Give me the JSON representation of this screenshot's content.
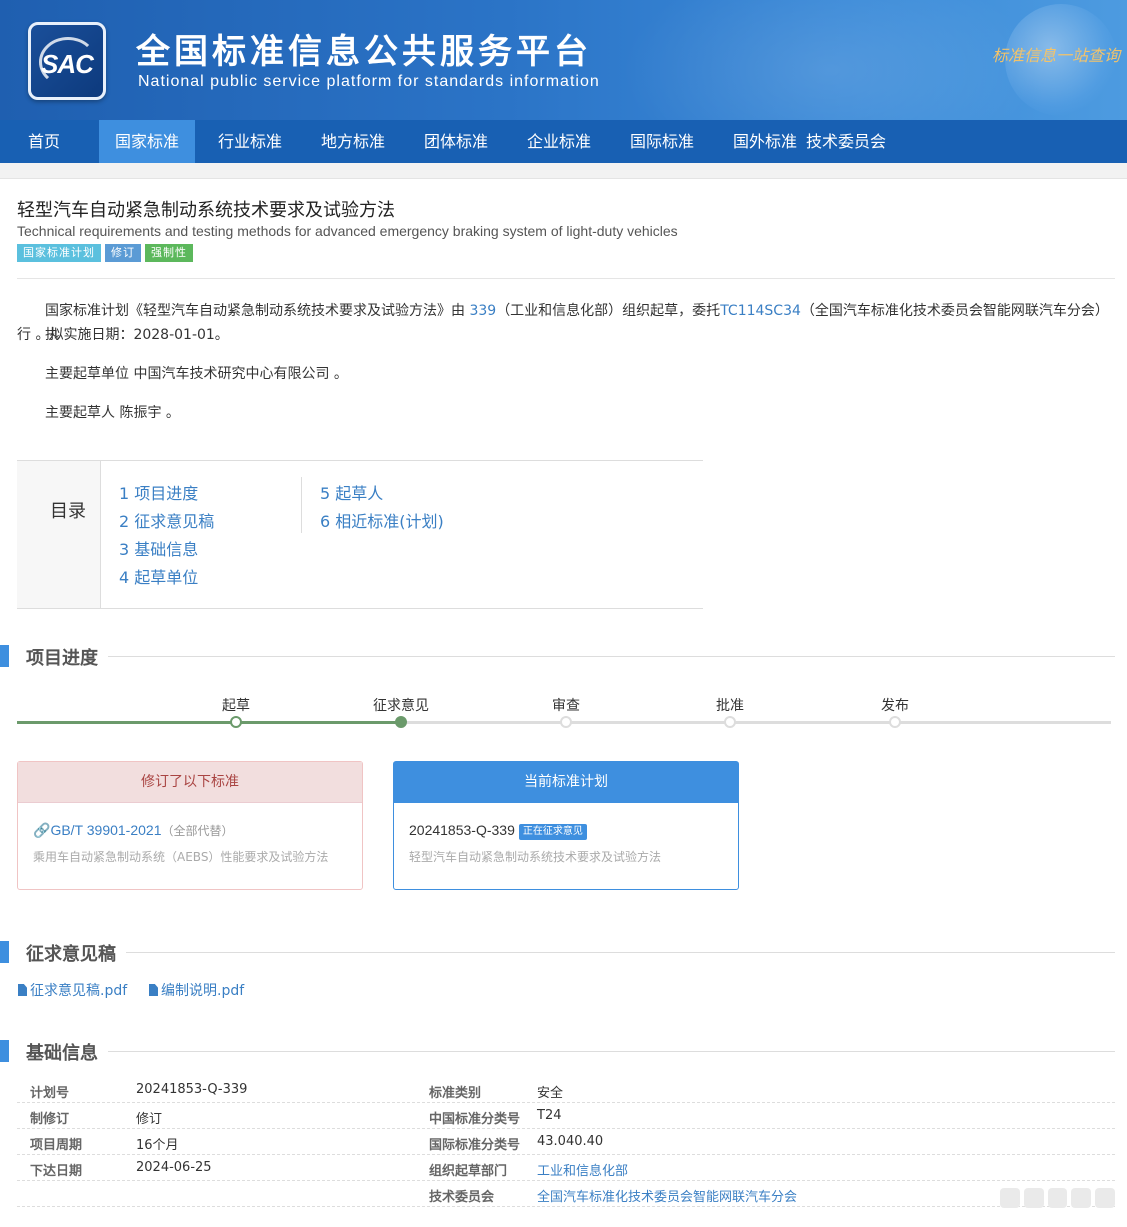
{
  "site": {
    "logo_text": "SAC",
    "title": "全国标准信息公共服务平台",
    "subtitle": "National public service platform  for standards information",
    "slogan": "标准信息一站查询"
  },
  "nav": [
    "首页",
    "国家标准",
    "行业标准",
    "地方标准",
    "团体标准",
    "企业标准",
    "国际标准",
    "国外标准",
    "技术委员会"
  ],
  "nav_active": "国家标准",
  "standard": {
    "title_cn": "轻型汽车自动紧急制动系统技术要求及试验方法",
    "title_en": "Technical requirements and testing methods for advanced emergency braking system of light-duty vehicles",
    "tags": [
      "国家标准计划",
      "修订",
      "强制性"
    ]
  },
  "intro": {
    "p1_a": "国家标准计划《轻型汽车自动紧急制动系统技术要求及试验方法》由 ",
    "p1_link1": "339",
    "p1_b": "（工业和信息化部）组织起草，委托",
    "p1_link2": "TC114SC34",
    "p1_c": "（全国汽车标准化技术委员会智能网联汽车分会）执",
    "p1_d": "行 。拟实施日期：2028-01-01。",
    "p2": "主要起草单位 中国汽车技术研究中心有限公司 。",
    "p3": "主要起草人 陈振宇 。"
  },
  "toc": {
    "title": "目录",
    "items": [
      "1  项目进度",
      "2  征求意见稿",
      "3  基础信息",
      "4  起草单位",
      "5  起草人",
      "6  相近标准(计划)"
    ]
  },
  "sections": {
    "progress": "项目进度",
    "draft": "征求意见稿",
    "basic": "基础信息"
  },
  "progress": {
    "steps": [
      "起草",
      "征求意见",
      "审查",
      "批准",
      "发布"
    ],
    "current_index": 1
  },
  "revised": {
    "header": "修订了以下标准",
    "code": "GB/T 39901-2021",
    "note": "（全部代替）",
    "name": "乘用车自动紧急制动系统（AEBS）性能要求及试验方法"
  },
  "current_plan": {
    "header": "当前标准计划",
    "code": "20241853-Q-339",
    "badge": "正在征求意见",
    "name": "轻型汽车自动紧急制动系统技术要求及试验方法"
  },
  "files": [
    "征求意见稿.pdf",
    "编制说明.pdf"
  ],
  "basic_info": [
    {
      "l1": "计划号",
      "v1": "20241853-Q-339",
      "l2": "标准类别",
      "v2": "安全"
    },
    {
      "l1": "制修订",
      "v1": "修订",
      "l2": "中国标准分类号",
      "v2": "T24"
    },
    {
      "l1": "项目周期",
      "v1": "16个月",
      "l2": "国际标准分类号",
      "v2": "43.040.40"
    },
    {
      "l1": "下达日期",
      "v1": "2024-06-25",
      "l2": "组织起草部门",
      "v2": "工业和信息化部"
    },
    {
      "l1": "",
      "v1": "",
      "l2": "技术委员会",
      "v2": "全国汽车标准化技术委员会智能网联汽车分会"
    }
  ],
  "colors": {
    "brand": "#1860b3",
    "accent": "#3e8fdf",
    "link": "#3a7fc4",
    "progress_done": "#6b9a6b"
  }
}
